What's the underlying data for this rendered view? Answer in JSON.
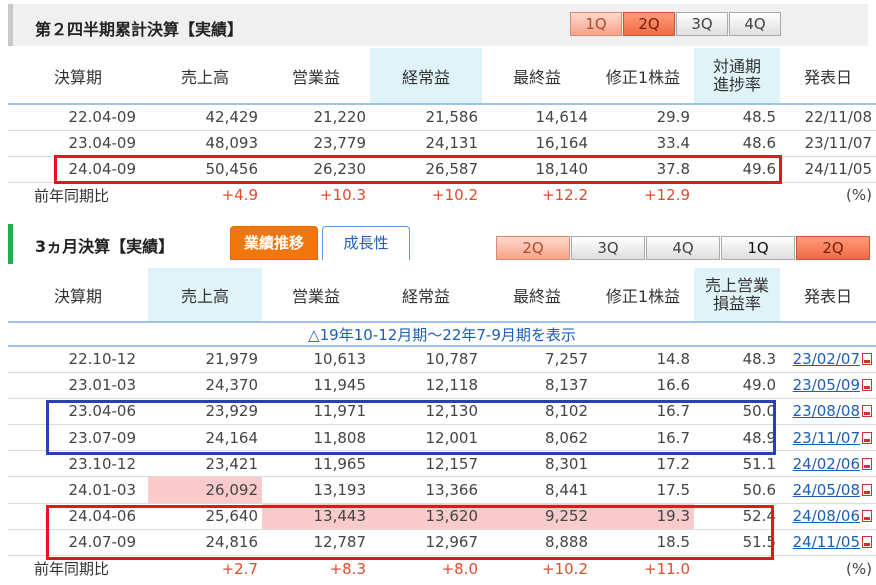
{
  "section1": {
    "title": "第２四半期累計決算【実績】",
    "quarter_buttons": [
      "1Q",
      "2Q",
      "3Q",
      "4Q"
    ],
    "headers": [
      "決算期",
      "売上高",
      "営業益",
      "経常益",
      "最終益",
      "修正1株益",
      "対通期\n進捗率",
      "発表日"
    ],
    "rows": [
      [
        "22.04-09",
        "42,429",
        "21,220",
        "21,586",
        "14,614",
        "29.9",
        "48.5",
        "22/11/08"
      ],
      [
        "23.04-09",
        "48,093",
        "23,779",
        "24,131",
        "16,164",
        "33.4",
        "48.6",
        "23/11/07"
      ],
      [
        "24.04-09",
        "50,456",
        "26,230",
        "26,587",
        "18,140",
        "37.8",
        "49.6",
        "24/11/05"
      ]
    ],
    "yoy": [
      "前年同期比",
      "+4.9",
      "+10.3",
      "+10.2",
      "+12.2",
      "+12.9",
      "",
      "(%)"
    ]
  },
  "section2": {
    "title": "3ヵ月決算【実績】",
    "tabs": [
      "業績推移",
      "成長性"
    ],
    "quarter_buttons": [
      "2Q",
      "3Q",
      "4Q",
      "1Q",
      "2Q"
    ],
    "headers": [
      "決算期",
      "売上高",
      "営業益",
      "経常益",
      "最終益",
      "修正1株益",
      "売上営業\n損益率",
      "発表日"
    ],
    "note": "△19年10-12月期～22年7-9月期を表示",
    "rows": [
      [
        "22.10-12",
        "21,979",
        "10,613",
        "10,787",
        "7,257",
        "14.8",
        "48.3",
        "23/02/07"
      ],
      [
        "23.01-03",
        "24,370",
        "11,945",
        "12,118",
        "8,137",
        "16.6",
        "49.0",
        "23/05/09"
      ],
      [
        "23.04-06",
        "23,929",
        "11,971",
        "12,130",
        "8,102",
        "16.7",
        "50.0",
        "23/08/08"
      ],
      [
        "23.07-09",
        "24,164",
        "11,808",
        "12,001",
        "8,062",
        "16.7",
        "48.9",
        "23/11/07"
      ],
      [
        "23.10-12",
        "23,421",
        "11,965",
        "12,157",
        "8,301",
        "17.2",
        "51.1",
        "24/02/06"
      ],
      [
        "24.01-03",
        "26,092",
        "13,193",
        "13,366",
        "8,441",
        "17.5",
        "50.6",
        "24/05/08"
      ],
      [
        "24.04-06",
        "25,640",
        "13,443",
        "13,620",
        "9,252",
        "19.3",
        "52.4",
        "24/08/06"
      ],
      [
        "24.07-09",
        "24,816",
        "12,787",
        "12,967",
        "8,888",
        "18.5",
        "51.5",
        "24/11/05"
      ]
    ],
    "yoy": [
      "前年同期比",
      "+2.7",
      "+8.3",
      "+8.0",
      "+10.2",
      "+11.0",
      "",
      "(%)"
    ]
  },
  "colors": {
    "positive": "#e24b2a",
    "highlight_red": "#e3161f",
    "highlight_blue": "#2a3fb5",
    "pink_cell": "#fbcaca",
    "link": "#1c5fb6",
    "header_bg": "#dff3f8",
    "tab_active": "#f2760e"
  }
}
